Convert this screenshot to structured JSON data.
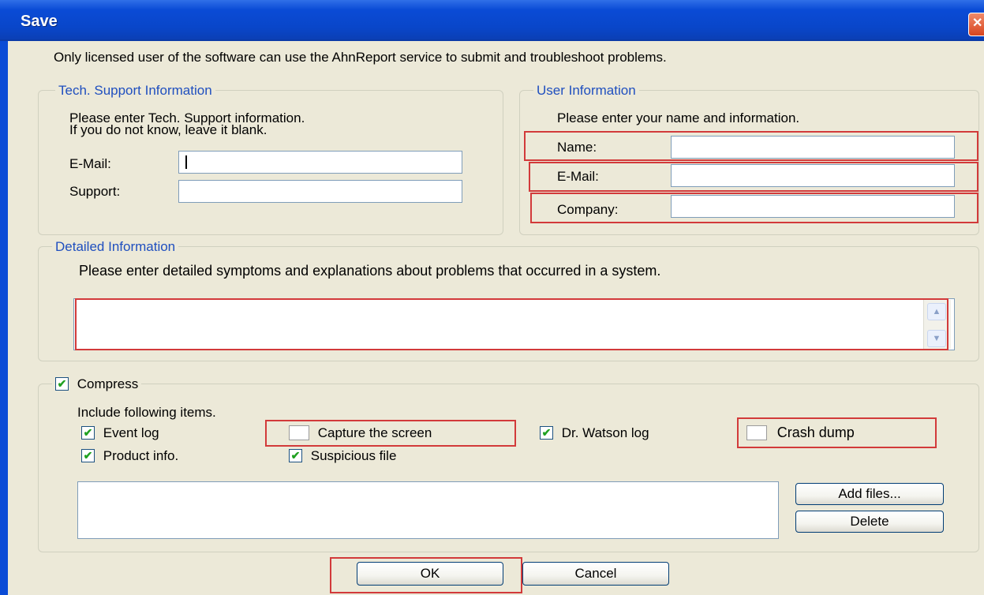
{
  "window": {
    "title": "Save",
    "close_icon": "close-icon"
  },
  "intro_text": "Only licensed user of the software can use the AhnReport service to submit and troubleshoot problems.",
  "tech_support": {
    "legend": "Tech. Support Information",
    "instruction_line1": "Please enter Tech. Support information.",
    "instruction_line2": "If you do not know, leave it blank.",
    "email_label": "E-Mail:",
    "email_value": "",
    "support_label": "Support:",
    "support_value": ""
  },
  "user_info": {
    "legend": "User Information",
    "instruction": "Please enter your name and information.",
    "name_label": "Name:",
    "name_value": "",
    "email_label": "E-Mail:",
    "email_value": "",
    "company_label": "Company:",
    "company_value": ""
  },
  "detailed": {
    "legend": "Detailed Information",
    "instruction": "Please enter detailed symptoms and explanations about problems that occurred in a system.",
    "value": ""
  },
  "compress": {
    "label": "Compress",
    "checked": true,
    "include_label": "Include following items.",
    "items": [
      {
        "label": "Event log",
        "checked": true
      },
      {
        "label": "Capture the screen",
        "checked": false
      },
      {
        "label": "Dr. Watson log",
        "checked": true
      },
      {
        "label": "Crash dump",
        "checked": false
      },
      {
        "label": "Product info.",
        "checked": true
      },
      {
        "label": "Suspicious file",
        "checked": true
      }
    ],
    "files": [],
    "add_files_label": "Add files...",
    "delete_label": "Delete"
  },
  "buttons": {
    "ok_label": "OK",
    "cancel_label": "Cancel"
  },
  "colors": {
    "titlebar": "#0a4bd6",
    "legend_text": "#1f4fbf",
    "highlight_border": "#d23a3a",
    "check_mark": "#21a121",
    "dialog_bg": "#ece9d8"
  }
}
